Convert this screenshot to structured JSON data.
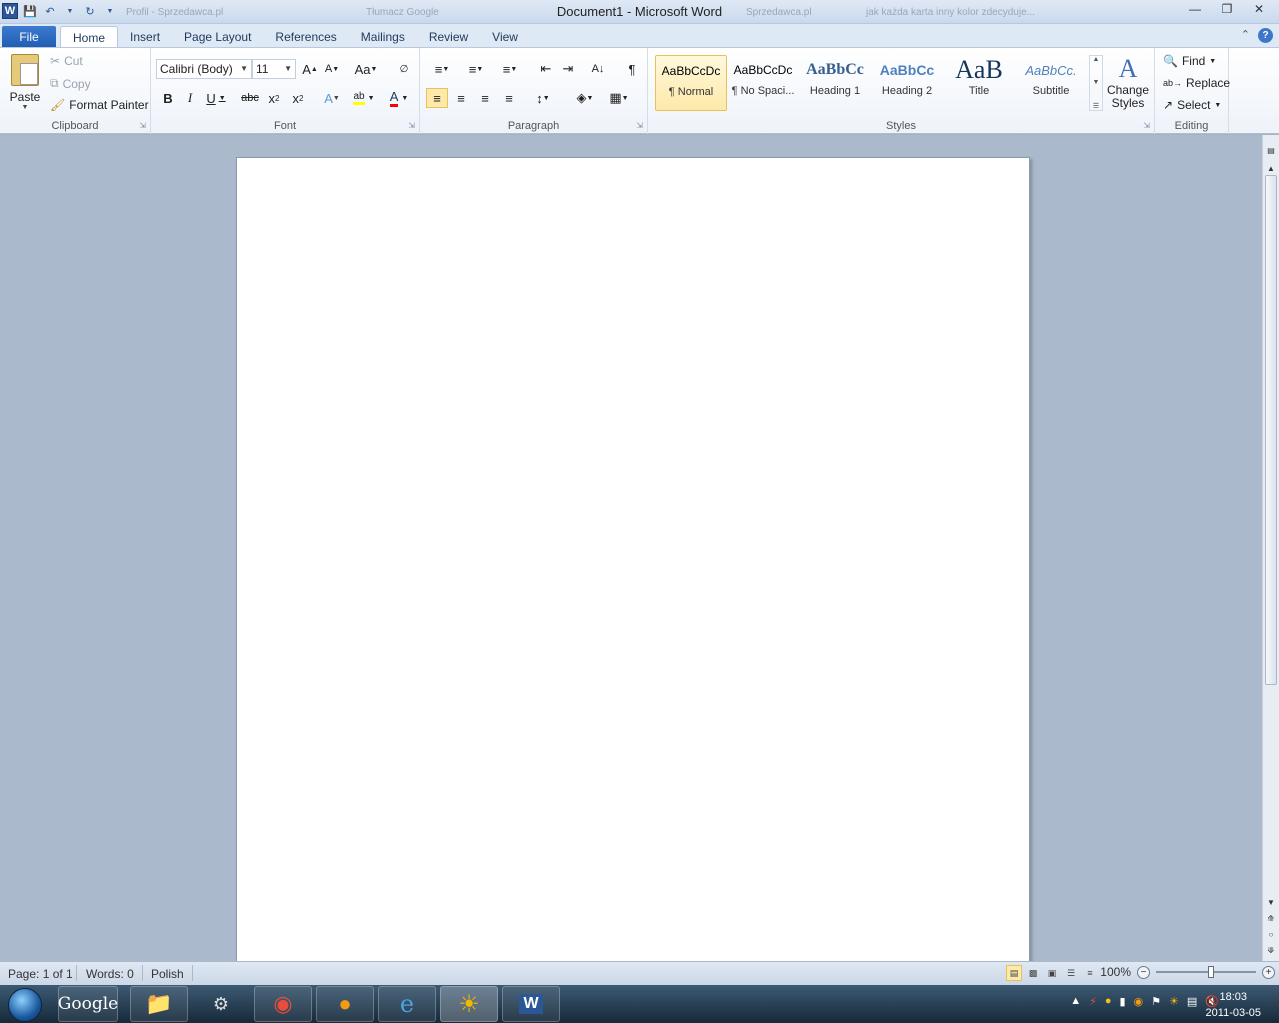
{
  "window": {
    "title": "Document1 - Microsoft Word"
  },
  "background_tabs": [
    "Profil - Sprzedawca.pl",
    "Tłumacz Google",
    "Sprzedawca.pl",
    "jak każda karta inny kolor zdecyduje..."
  ],
  "tabs": {
    "file": "File",
    "items": [
      "Home",
      "Insert",
      "Page Layout",
      "References",
      "Mailings",
      "Review",
      "View"
    ],
    "active": "Home"
  },
  "clipboard": {
    "group_label": "Clipboard",
    "paste": "Paste",
    "cut": "Cut",
    "copy": "Copy",
    "format_painter": "Format Painter"
  },
  "font": {
    "group_label": "Font",
    "family": "Calibri (Body)",
    "size": "11"
  },
  "paragraph": {
    "group_label": "Paragraph"
  },
  "styles": {
    "group_label": "Styles",
    "items": [
      {
        "sample": "AaBbCcDc",
        "name": "¶ Normal"
      },
      {
        "sample": "AaBbCcDc",
        "name": "¶ No Spaci..."
      },
      {
        "sample": "AaBbCc",
        "name": "Heading 1"
      },
      {
        "sample": "AaBbCc",
        "name": "Heading 2"
      },
      {
        "sample": "AaB",
        "name": "Title"
      },
      {
        "sample": "AaBbCc.",
        "name": "Subtitle"
      }
    ],
    "change_styles": "Change Styles"
  },
  "editing": {
    "group_label": "Editing",
    "find": "Find",
    "replace": "Replace",
    "select": "Select"
  },
  "status": {
    "page": "Page: 1 of 1",
    "words": "Words: 0",
    "language": "Polish",
    "zoom": "100%",
    "zoom_value": 100
  },
  "taskbar": {
    "google_label": "Google"
  },
  "clock": {
    "time": "18:03",
    "date": "2011-03-05"
  },
  "colors": {
    "file_tab": "#2b5797",
    "highlight": "#ffff00",
    "font_color": "#ff0000",
    "selected_style": "#fde9a9"
  }
}
